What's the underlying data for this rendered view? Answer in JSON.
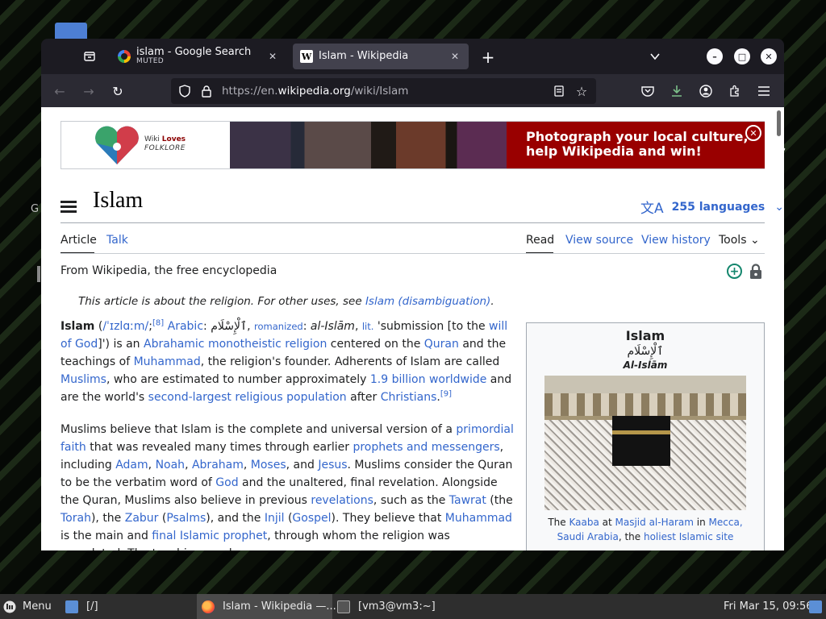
{
  "browser": {
    "tabs": [
      {
        "title": "islam - Google Search",
        "subtitle": "MUTED",
        "close": "✕"
      },
      {
        "title": "Islam - Wikipedia",
        "close": "✕"
      }
    ],
    "new_tab": "+",
    "list_all_tabs": "⌄",
    "window_controls": {
      "minimize": "–",
      "maximize": "□",
      "close": "✕"
    },
    "url": {
      "prefix": "https://en.",
      "domain": "wikipedia.org",
      "path": "/wiki/Islam"
    },
    "nav": {
      "back": "←",
      "forward": "→",
      "reload": "↻"
    }
  },
  "banner": {
    "logo_line1": "Wiki",
    "logo_line1b": "Loves",
    "logo_line2": "FOLKLORE",
    "headline_line1": "Photograph your local culture,",
    "headline_line2": "help Wikipedia and win!",
    "close": "✕"
  },
  "article": {
    "title": "Islam",
    "languages": "255 languages",
    "tabs": {
      "article": "Article",
      "talk": "Talk",
      "read": "Read",
      "view_source": "View source",
      "view_history": "View history",
      "tools": "Tools"
    },
    "tagline": "From Wikipedia, the free encyclopedia",
    "hatnote": {
      "text": "This article is about the religion. For other uses, see ",
      "link": "Islam (disambiguation)",
      "end": "."
    },
    "p1": {
      "t1": "Islam",
      "t2": " (",
      "ipa": "/ˈɪzlɑːm/",
      "t3": ";",
      "ref8": "[8]",
      "t4": " ",
      "arabic": "Arabic",
      "t5": ": ",
      "arabic_text": "ٱلْإِسْلَام",
      "t6": ", ",
      "romanized": "romanized",
      "t7": ": ",
      "translit": "al-Islām",
      "t8": ", ",
      "lit": "lit.",
      "t9": " 'submission [to the ",
      "will_of_god": "will of God",
      "t10": "]') is an ",
      "abrahamic": "Abrahamic monotheistic religion",
      "t11": " centered on the ",
      "quran": "Quran",
      "t12": " and the teachings of ",
      "muhammad": "Muhammad",
      "t13": ", the religion's founder. Adherents of Islam are called ",
      "muslims": "Muslims",
      "t14": ", who are estimated to number approximately ",
      "billion": "1.9 billion worldwide",
      "t15": " and are the world's ",
      "second_largest": "second-largest religious population",
      "t16": " after ",
      "christians": "Christians",
      "t17": ".",
      "ref9": "[9]"
    },
    "p2": {
      "t1": "Muslims believe that Islam is the complete and universal version of a ",
      "primordial": "primordial faith",
      "t2": " that was revealed many times through earlier ",
      "prophets": "prophets and messengers",
      "t3": ", including ",
      "adam": "Adam",
      "c1": ", ",
      "noah": "Noah",
      "c2": ", ",
      "abraham": "Abraham",
      "c3": ", ",
      "moses": "Moses",
      "t4": ", and ",
      "jesus": "Jesus",
      "t5": ". Muslims consider the Quran to be the verbatim word of ",
      "god": "God",
      "t6": " and the unaltered, final revelation. Alongside the Quran, Muslims also believe in previous ",
      "revelations": "revelations",
      "t7": ", such as the ",
      "tawrat": "Tawrat",
      "t8": " (the ",
      "torah": "Torah",
      "t9": "), the ",
      "zabur": "Zabur",
      "t10": " (",
      "psalms": "Psalms",
      "t11": "), and the ",
      "injil": "Injil",
      "t12": " (",
      "gospel": "Gospel",
      "t13": "). They believe that ",
      "muhammad": "Muhammad",
      "t14": " is the main and ",
      "final_prophet": "final Islamic prophet",
      "t15": ", through whom the religion was completed. The teachings and"
    }
  },
  "infobox": {
    "title": "Islam",
    "native": "ٱلْإِسْلَام",
    "translit": "Al-Islām",
    "caption": {
      "t1": "The ",
      "kaaba": "Kaaba",
      "t2": " at ",
      "masjid": "Masjid al-Haram",
      "t3": " in ",
      "mecca": "Mecca, Saudi Arabia",
      "t4": ", the ",
      "holiest": "holiest Islamic site"
    }
  },
  "taskbar": {
    "menu": "Menu",
    "folder": "[/]",
    "firefox": "Islam - Wikipedia —...",
    "terminal": "[vm3@vm3:~]",
    "clock": "Fri Mar 15, 09:56"
  },
  "colors": {
    "link": "#3366cc",
    "banner_red": "#990000",
    "chrome_bg": "#1c1b22"
  }
}
